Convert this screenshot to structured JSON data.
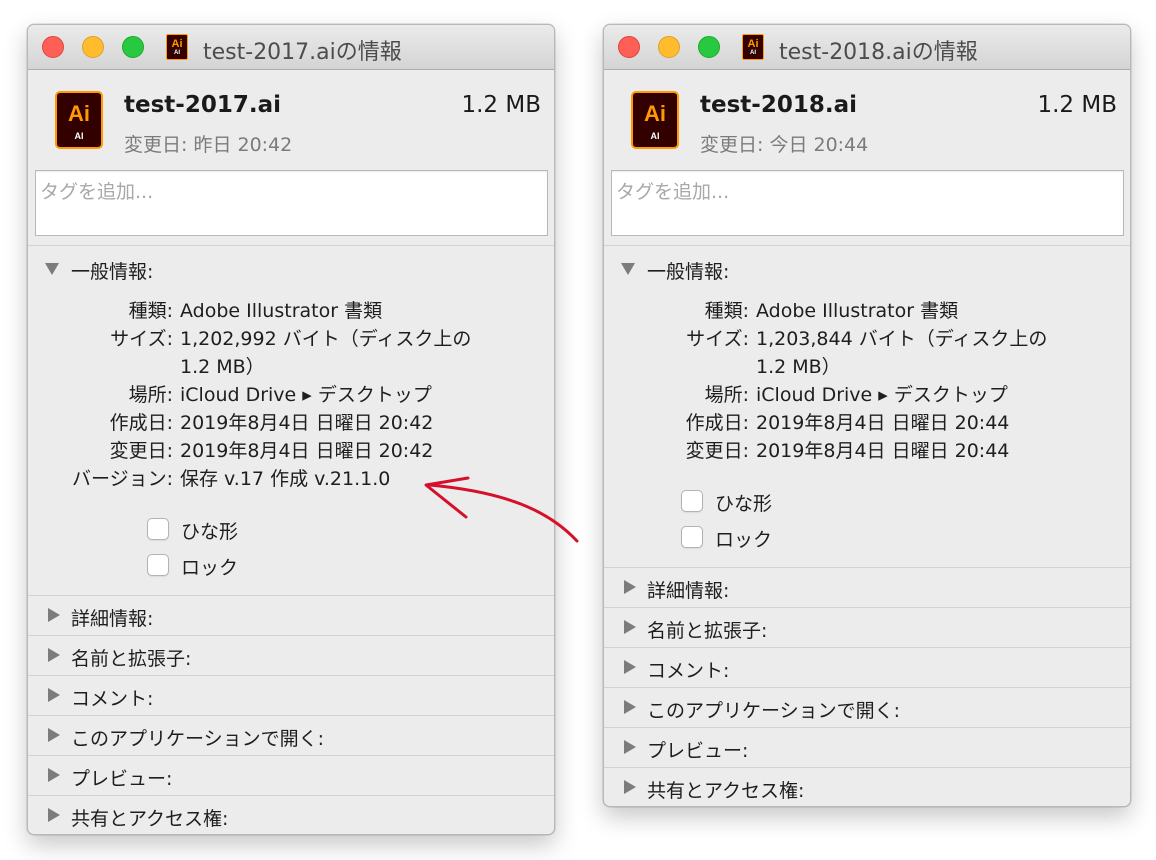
{
  "left_window": {
    "title": "test-2017.aiの情報",
    "file_name": "test-2017.ai",
    "file_size": "1.2 MB",
    "modified_summary": "変更日: 昨日 20:42",
    "icon_text": "Ai",
    "icon_subtext": "AI",
    "tags_placeholder": "タグを追加...",
    "general_label": "一般情報:",
    "info": [
      {
        "key": "種類:",
        "value": "Adobe Illustrator 書類"
      },
      {
        "key": "サイズ:",
        "value": "1,202,992 バイト（ディスク上の"
      },
      {
        "key": "",
        "value": "1.2 MB）"
      },
      {
        "key": "場所:",
        "value": "iCloud Drive ▸ デスクトップ"
      },
      {
        "key": "作成日:",
        "value": "2019年8月4日 日曜日 20:42"
      },
      {
        "key": "変更日:",
        "value": "2019年8月4日 日曜日 20:42"
      },
      {
        "key": "バージョン:",
        "value": "保存  v.17 作成  v.21.1.0"
      }
    ],
    "checkboxes": [
      {
        "label": "ひな形",
        "checked": false
      },
      {
        "label": "ロック",
        "checked": false
      }
    ],
    "sections": [
      "詳細情報:",
      "名前と拡張子:",
      "コメント:",
      "このアプリケーションで開く:",
      "プレビュー:",
      "共有とアクセス権:"
    ]
  },
  "right_window": {
    "title": "test-2018.aiの情報",
    "file_name": "test-2018.ai",
    "file_size": "1.2 MB",
    "modified_summary": "変更日: 今日 20:44",
    "icon_text": "Ai",
    "icon_subtext": "AI",
    "tags_placeholder": "タグを追加...",
    "general_label": "一般情報:",
    "info": [
      {
        "key": "種類:",
        "value": "Adobe Illustrator 書類"
      },
      {
        "key": "サイズ:",
        "value": "1,203,844 バイト（ディスク上の"
      },
      {
        "key": "",
        "value": "1.2 MB）"
      },
      {
        "key": "場所:",
        "value": "iCloud Drive ▸ デスクトップ"
      },
      {
        "key": "作成日:",
        "value": "2019年8月4日 日曜日 20:44"
      },
      {
        "key": "変更日:",
        "value": "2019年8月4日 日曜日 20:44"
      }
    ],
    "checkboxes": [
      {
        "label": "ひな形",
        "checked": false
      },
      {
        "label": "ロック",
        "checked": false
      }
    ],
    "sections": [
      "詳細情報:",
      "名前と拡張子:",
      "コメント:",
      "このアプリケーションで開く:",
      "プレビュー:",
      "共有とアクセス権:"
    ]
  },
  "colors": {
    "annotation_arrow": "#d4102a",
    "illustrator_orange": "#ff9a00",
    "illustrator_dark": "#330000"
  }
}
